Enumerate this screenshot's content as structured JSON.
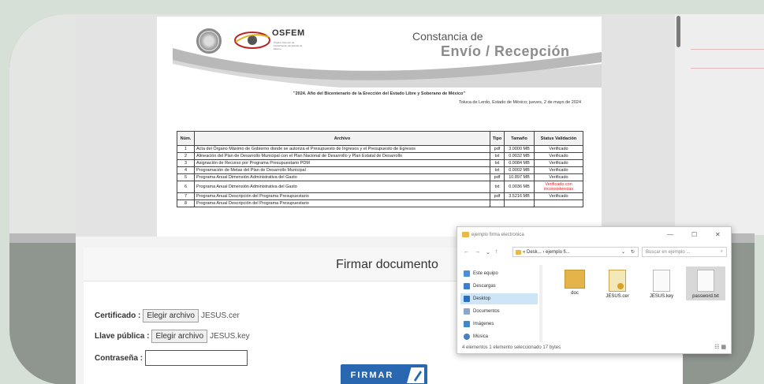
{
  "pdf": {
    "brand": "OSFEM",
    "brand_sub": "Órgano Superior de Fiscalización del Estado de México",
    "doc_title_line1": "Constancia de",
    "doc_title_line2": "Envío / Recepción",
    "year_motto": "\"2024. Año del Bicentenario de la Erección del Estado Libre y Soberano de México\"",
    "place_date": "Toluca de Lerdo, Estado de México; jueves, 2 de mayo de 2024",
    "table": {
      "headers": [
        "Núm.",
        "Archivo",
        "Tipo",
        "Tamaño",
        "Status Validación"
      ],
      "rows": [
        [
          "1",
          "Acta del Órgano Máximo de Gobierno donde se autoriza el Presupuesto de Ingresos y el Presupuesto de Egresos",
          "pdf",
          "3.0000 MB",
          "Verificado"
        ],
        [
          "2",
          "Alineación del Plan de Desarrollo Municipal con el Plan Nacional de Desarrollo y Plan Estatal de Desarrollo",
          "txt",
          "0.0032 MB",
          "Verificado"
        ],
        [
          "3",
          "Asignación de Recurso por Programa Presupuestario PDM",
          "txt",
          "0.0084 MB",
          "Verificado"
        ],
        [
          "4",
          "Programación de Metas del Plan de Desarrollo Municipal",
          "txt",
          "0.0002 MB",
          "Verificado"
        ],
        [
          "5",
          "Programa Anual Dimensión Administrativa del Gasto",
          "pdf",
          "10.897 MB",
          "Verificado"
        ],
        [
          "6",
          "Programa Anual Dimensión Administrativa del Gasto",
          "txt",
          "0.0036 MB",
          "Verificado con inconsistencias"
        ],
        [
          "7",
          "Programa Anual Descripción del Programa Presupuestario",
          "pdf",
          "3.5216 MB",
          "Verificado"
        ],
        [
          "8",
          "Programa Anual Descripción del Programa Presupuestario",
          "",
          "",
          ""
        ]
      ]
    }
  },
  "form": {
    "title": "Firmar documento",
    "cert_label": "Certificado :",
    "cert_button": "Elegir archivo",
    "cert_file": "JESUS.cer",
    "key_label": "Llave pública :",
    "key_button": "Elegir archivo",
    "key_file": "JESUS.key",
    "password_label": "Contraseña :",
    "password_value": "",
    "sign_button": "FIRMAR"
  },
  "explorer": {
    "title": "ejemplo firma electronica",
    "minimize": "—",
    "maximize": "☐",
    "close": "✕",
    "nav_back": "←",
    "nav_forward": "→",
    "nav_recent": "⌄",
    "nav_up": "↑",
    "address": "« Desk... › ejemplo fi...",
    "address_dropdown": "⌄",
    "refresh": "↻",
    "search_placeholder": "Buscar en ejemplo ...",
    "search_icon": "⌕",
    "sidebar": [
      {
        "label": "Este equipo",
        "icon": "computer-icon"
      },
      {
        "label": "Descargas",
        "icon": "download-icon"
      },
      {
        "label": "Desktop",
        "icon": "desktop-icon",
        "selected": true
      },
      {
        "label": "Documentos",
        "icon": "documents-icon"
      },
      {
        "label": "Imágenes",
        "icon": "images-icon"
      },
      {
        "label": "Música",
        "icon": "music-icon"
      }
    ],
    "files": [
      {
        "name": "doc",
        "icon": "folder-icon"
      },
      {
        "name": "JESUS.cer",
        "icon": "certificate-file-icon"
      },
      {
        "name": "JESUS.key",
        "icon": "key-file-icon"
      },
      {
        "name": "password.txt",
        "icon": "text-file-icon",
        "selected": true
      }
    ],
    "status": "4 elementos    1 elemento seleccionado  17 bytes",
    "view_icons": "☷ ▦"
  }
}
